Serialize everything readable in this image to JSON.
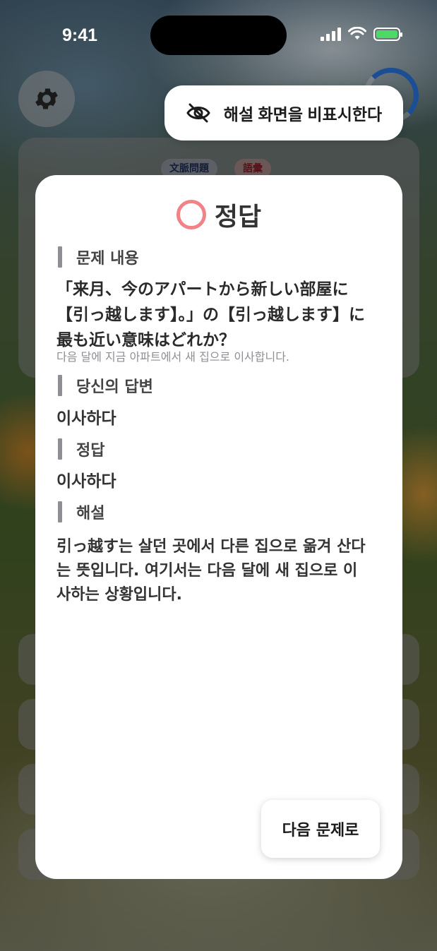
{
  "status_bar": {
    "time": "9:41"
  },
  "background": {
    "tags": [
      "文脈問題",
      "語彙"
    ]
  },
  "toggle_button": {
    "label": "해설 화면을 비표시한다",
    "icon": "eye-slash-icon"
  },
  "result": {
    "icon": "circle-correct-icon",
    "title": "정답"
  },
  "sections": {
    "question_heading": "문제 내용",
    "question_text": "「来月、今のアパートから新しい部屋に【引っ越します】。」の【引っ越します】に最も近い意味はどれか？",
    "question_translation": "다음 달에 지금 아파트에서 새 집으로 이사합니다.",
    "your_answer_heading": "당신의 답변",
    "your_answer": "이사하다",
    "correct_heading": "정답",
    "correct_answer": "이사하다",
    "explanation_heading": "해설",
    "explanation": "引っ越す는 살던 곳에서 다른 집으로 옮겨 산다는 뜻입니다. 여기서는 다음 달에 새 집으로 이사하는 상황입니다."
  },
  "next_button": {
    "label": "다음 문제로"
  },
  "colors": {
    "correct_circle": "#f08288",
    "progress_accent": "#2e7ef0",
    "battery": "#4cd964"
  }
}
